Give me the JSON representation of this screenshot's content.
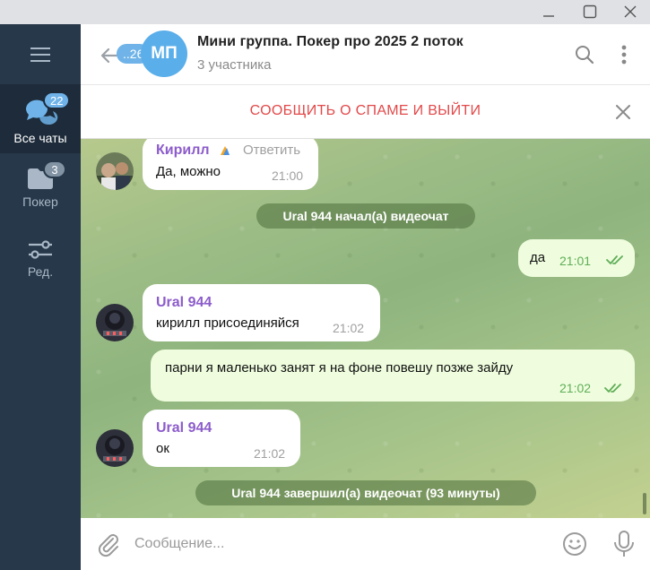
{
  "sidebar": {
    "menu_icon": "hamburger-icon",
    "items": [
      {
        "label": "Все чаты",
        "badge": "22",
        "icon": "chats-icon",
        "active": true
      },
      {
        "label": "Покер",
        "badge": "3",
        "icon": "folder-icon",
        "active": false
      },
      {
        "label": "Ред.",
        "badge": "",
        "icon": "sliders-icon",
        "active": false
      }
    ]
  },
  "header": {
    "back_badge": "..26",
    "avatar_initials": "МП",
    "title": "Мини группа. Покер про 2025 2 поток",
    "subtitle": "3 участника"
  },
  "spam_bar": {
    "label": "СООБЩИТЬ О СПАМЕ И ВЫЙТИ"
  },
  "messages": [
    {
      "type": "incoming",
      "sender": "Кирилл",
      "reply_label": "Ответить",
      "text": "Да, можно",
      "time": "21:00"
    },
    {
      "type": "service",
      "text": "Ural 944 начал(а) видеочат"
    },
    {
      "type": "outgoing",
      "text": "да",
      "time": "21:01"
    },
    {
      "type": "incoming",
      "sender": "Ural 944",
      "text": "кирилл присоединяйся",
      "time": "21:02"
    },
    {
      "type": "outgoing",
      "text": "парни я маленько занят я на фоне повешу позже зайду",
      "time": "21:02"
    },
    {
      "type": "incoming",
      "sender": "Ural 944",
      "text": "ок",
      "time": "21:02"
    },
    {
      "type": "service",
      "text": "Ural 944 завершил(а) видеочат (93 минуты)"
    }
  ],
  "composer": {
    "placeholder": "Сообщение..."
  },
  "colors": {
    "accent": "#5aaeea",
    "spam_red": "#e2494a",
    "sender_purple": "#8c5ccb",
    "outgoing_bubble": "#effdde",
    "sidebar_bg": "#27384a"
  }
}
